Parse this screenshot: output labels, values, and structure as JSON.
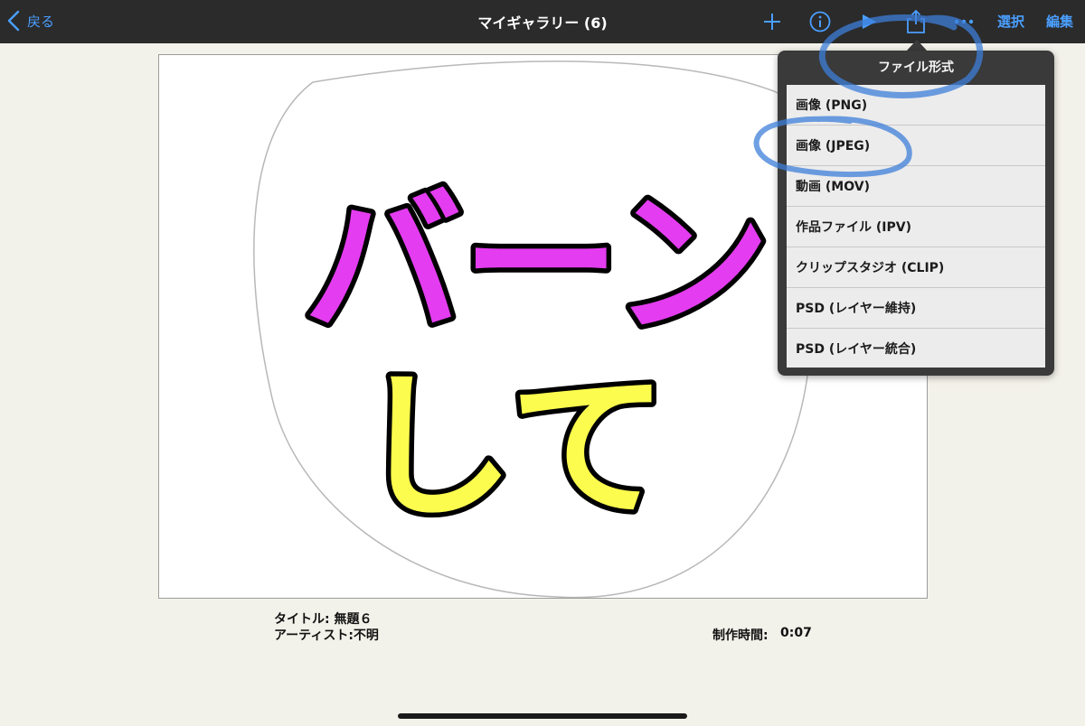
{
  "navbar": {
    "back_label": "戻る",
    "title": "マイギャラリー (6)",
    "select_label": "選択",
    "edit_label": "編集",
    "accent_color": "#4a9fff",
    "icons": [
      "add-icon",
      "info-icon",
      "play-icon",
      "share-icon",
      "more-icon"
    ]
  },
  "canvas": {
    "line1": "バーン",
    "line2": "して",
    "colors": {
      "line1_fill": "#e43cf0",
      "line2_fill": "#fcfc4e",
      "outline": "#000000"
    }
  },
  "meta": {
    "title_line": "タイトル: 無題６",
    "artist_line": "アーティスト:不明",
    "time_label": "制作時間:",
    "time_value": "0:07"
  },
  "popover": {
    "title": "ファイル形式",
    "items": [
      "画像 (PNG)",
      "画像 (JPEG)",
      "動画 (MOV)",
      "作品ファイル (IPV)",
      "クリップスタジオ (CLIP)",
      "PSD (レイヤー維持)",
      "PSD (レイヤー統合)"
    ]
  },
  "annotations": {
    "color": "#3d7fd9"
  }
}
